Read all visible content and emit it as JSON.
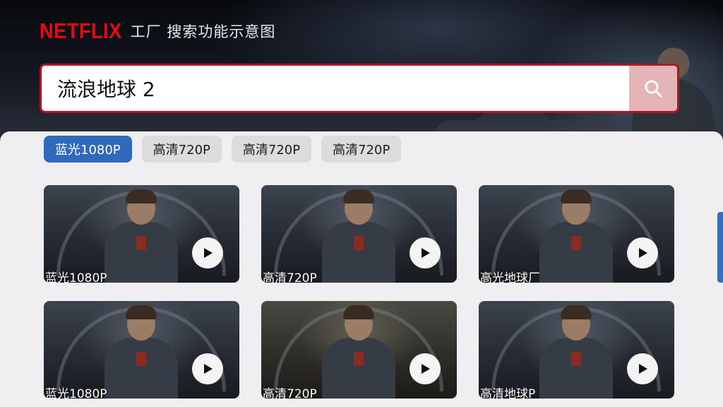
{
  "header": {
    "logo": "NETFLIX",
    "title": "工厂 搜索功能示意图"
  },
  "search": {
    "value": "流浪地球 2",
    "icon": "search-icon"
  },
  "filters": [
    {
      "label": "蓝光1080P",
      "active": true
    },
    {
      "label": "高清720P",
      "active": false
    },
    {
      "label": "高清720P",
      "active": false
    },
    {
      "label": "高清720P",
      "active": false
    }
  ],
  "results": [
    {
      "caption": "蓝光1080P",
      "icon": "play-icon"
    },
    {
      "caption": "高清720P",
      "icon": "play-icon"
    },
    {
      "caption": "高光地球厂",
      "icon": "play-icon"
    },
    {
      "caption": "蓝光1080P",
      "icon": "play-icon"
    },
    {
      "caption": "高清720P",
      "icon": "play-icon"
    },
    {
      "caption": "高清地球P",
      "icon": "play-icon"
    }
  ],
  "colors": {
    "brand": "#e50914",
    "accent": "#2f69bd",
    "search_border": "#b3151f"
  }
}
